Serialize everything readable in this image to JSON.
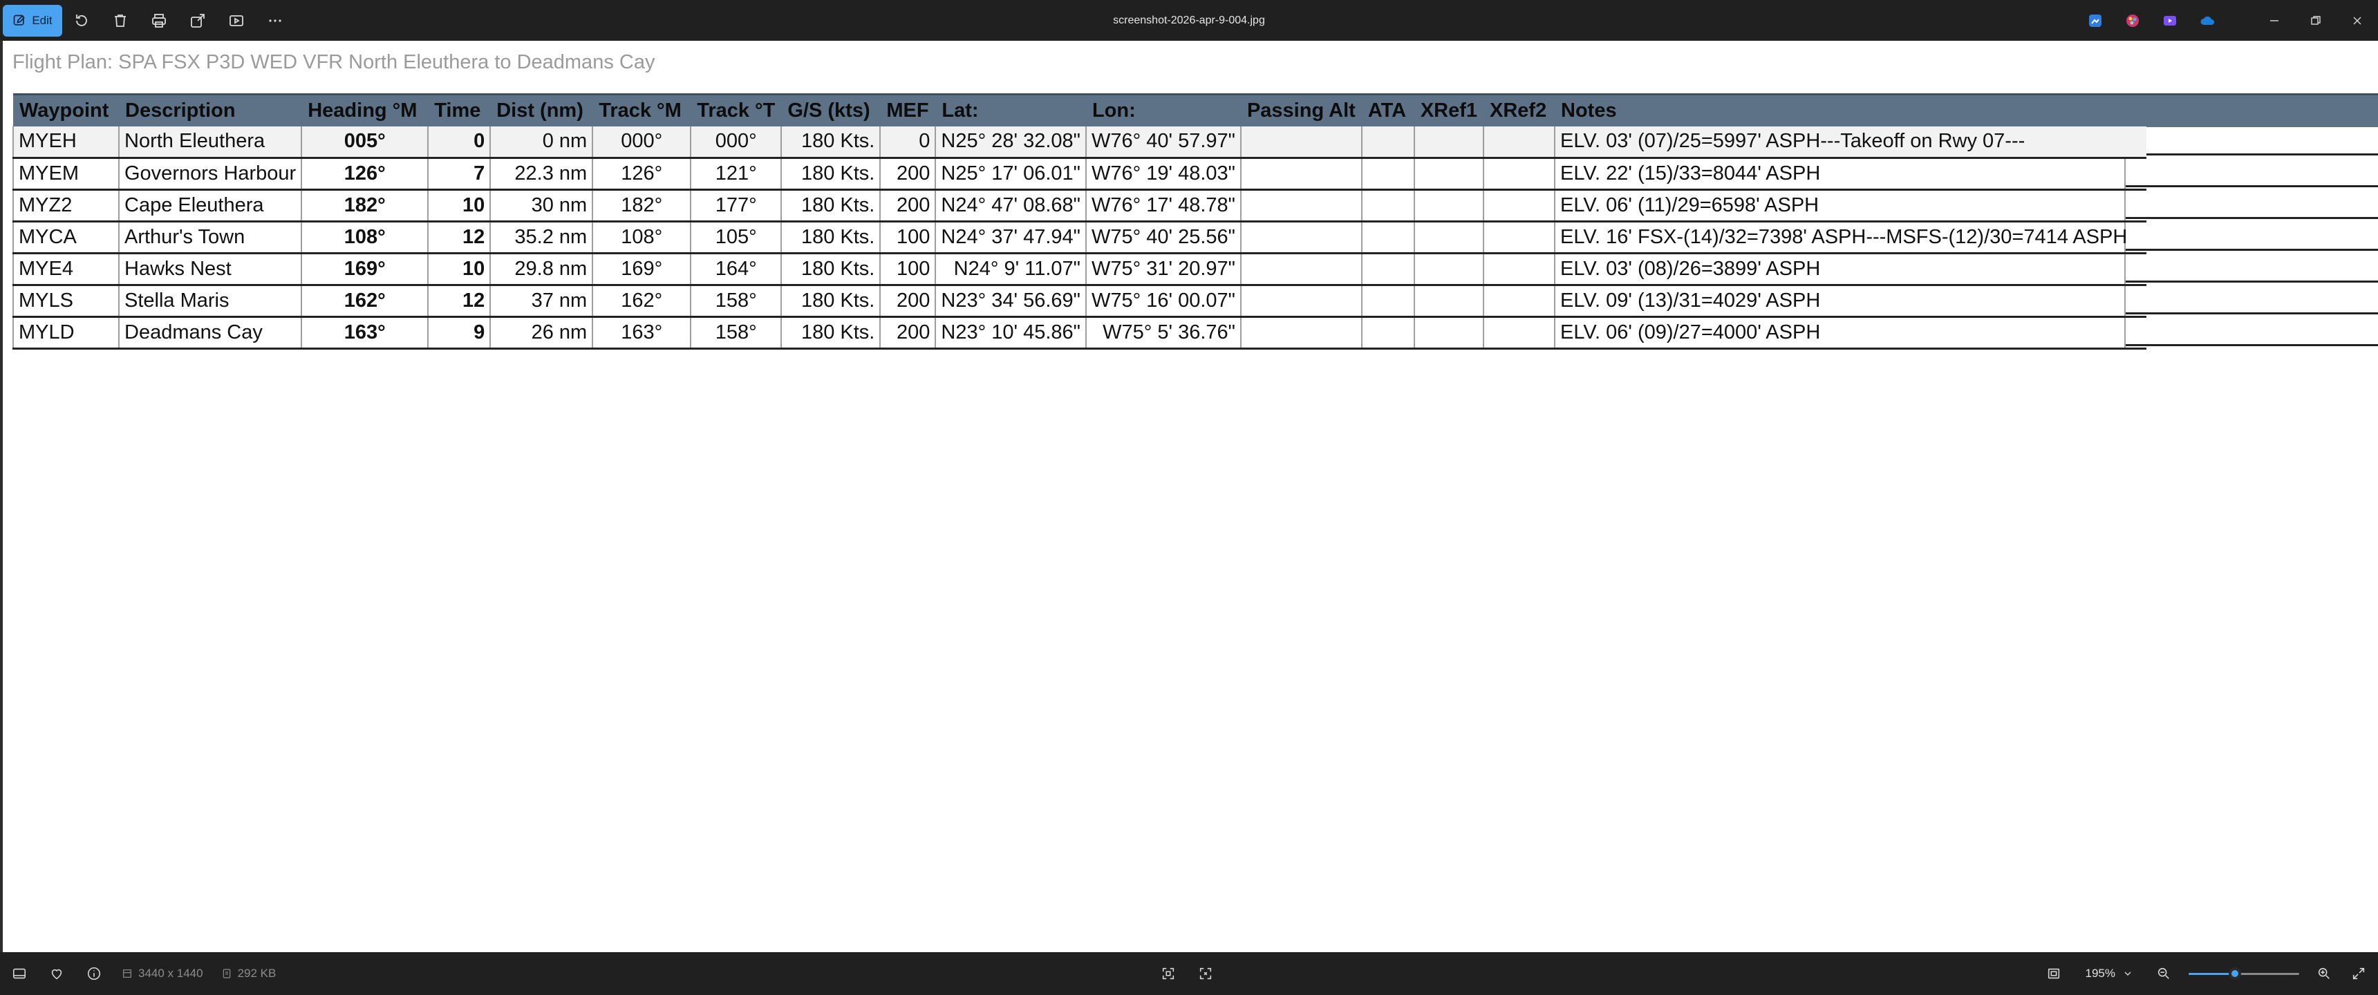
{
  "window": {
    "title": "screenshot-2026-apr-9-004.jpg",
    "edit_label": "Edit"
  },
  "toolbar_icons": [
    "rotate-icon",
    "delete-icon",
    "print-icon",
    "share-icon",
    "slideshow-icon",
    "more-icon"
  ],
  "plan_title": "Flight Plan: SPA FSX P3D WED VFR North Eleuthera to Deadmans Cay",
  "table": {
    "headers": [
      "Waypoint",
      "Description",
      "Heading °M",
      "Time",
      "Dist (nm)",
      "Track °M",
      "Track °T",
      "G/S (kts)",
      "MEF",
      "Lat:",
      "Lon:",
      "Passing Alt",
      "ATA",
      "XRef1",
      "XRef2",
      "Notes"
    ],
    "rows": [
      [
        "MYEH",
        "North Eleuthera",
        "005°",
        "0",
        "0 nm",
        "000°",
        "000°",
        "180 Kts.",
        "0",
        "N25° 28' 32.08\"",
        "W76° 40' 57.97\"",
        "",
        "",
        "",
        "",
        "ELV. 03'  (07)/25=5997' ASPH---Takeoff on Rwy 07---"
      ],
      [
        "MYEM",
        "Governors Harbour",
        "126°",
        "7",
        "22.3 nm",
        "126°",
        "121°",
        "180 Kts.",
        "200",
        "N25° 17' 06.01\"",
        "W76° 19' 48.03\"",
        "",
        "",
        "",
        "",
        "ELV. 22'  (15)/33=8044' ASPH"
      ],
      [
        "MYZ2",
        "Cape Eleuthera",
        "182°",
        "10",
        "30 nm",
        "182°",
        "177°",
        "180 Kts.",
        "200",
        "N24° 47' 08.68\"",
        "W76° 17' 48.78\"",
        "",
        "",
        "",
        "",
        "ELV. 06'  (11)/29=6598' ASPH"
      ],
      [
        "MYCA",
        "Arthur's Town",
        "108°",
        "12",
        "35.2 nm",
        "108°",
        "105°",
        "180 Kts.",
        "100",
        "N24° 37' 47.94\"",
        "W75° 40' 25.56\"",
        "",
        "",
        "",
        "",
        "ELV. 16'  FSX-(14)/32=7398' ASPH---MSFS-(12)/30=7414 ASPH"
      ],
      [
        "MYE4",
        "Hawks Nest",
        "169°",
        "10",
        "29.8 nm",
        "169°",
        "164°",
        "180 Kts.",
        "100",
        "N24° 9' 11.07\"",
        "W75° 31' 20.97\"",
        "",
        "",
        "",
        "",
        "ELV. 03'  (08)/26=3899' ASPH"
      ],
      [
        "MYLS",
        "Stella Maris",
        "162°",
        "12",
        "37 nm",
        "162°",
        "158°",
        "180 Kts.",
        "200",
        "N23° 34' 56.69\"",
        "W75° 16' 00.07\"",
        "",
        "",
        "",
        "",
        "ELV. 09'  (13)/31=4029' ASPH"
      ],
      [
        "MYLD",
        "Deadmans Cay",
        "163°",
        "9",
        "26 nm",
        "163°",
        "158°",
        "180 Kts.",
        "200",
        "N23° 10' 45.86\"",
        "W75° 5' 36.76\"",
        "",
        "",
        "",
        "",
        "ELV. 06'  (09)/27=4000' ASPH"
      ]
    ]
  },
  "statusbar": {
    "dimensions": "3440 x 1440",
    "file_size": "292 KB",
    "zoom": "195%",
    "zoom_fraction": 0.42
  },
  "colors": {
    "accent": "#4aa3f0",
    "header_bg": "#5e7287"
  }
}
